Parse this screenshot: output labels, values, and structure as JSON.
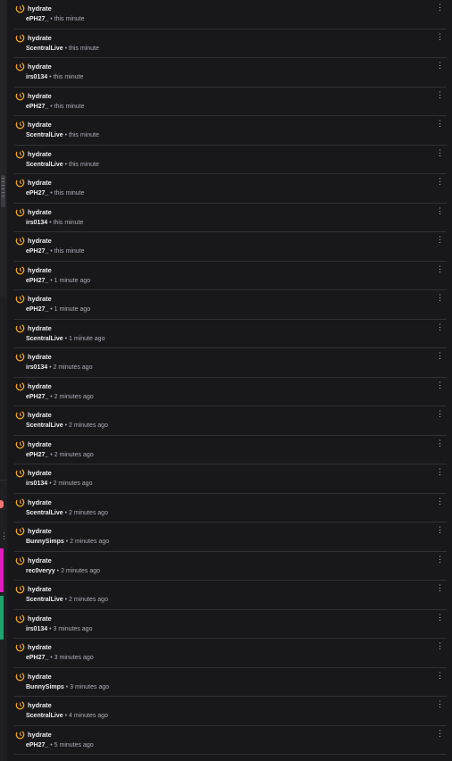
{
  "items": [
    {
      "title": "hydrate",
      "user": "ePH27_",
      "time": "this minute"
    },
    {
      "title": "hydrate",
      "user": "ScentralLive",
      "time": "this minute"
    },
    {
      "title": "hydrate",
      "user": "irs0134",
      "time": "this minute"
    },
    {
      "title": "hydrate",
      "user": "ePH27_",
      "time": "this minute"
    },
    {
      "title": "hydrate",
      "user": "ScentralLive",
      "time": "this minute"
    },
    {
      "title": "hydrate",
      "user": "ScentralLive",
      "time": "this minute"
    },
    {
      "title": "hydrate",
      "user": "ePH27_",
      "time": "this minute"
    },
    {
      "title": "hydrate",
      "user": "irs0134",
      "time": "this minute"
    },
    {
      "title": "hydrate",
      "user": "ePH27_",
      "time": "this minute"
    },
    {
      "title": "hydrate",
      "user": "ePH27_",
      "time": "1 minute ago"
    },
    {
      "title": "hydrate",
      "user": "ePH27_",
      "time": "1 minute ago"
    },
    {
      "title": "hydrate",
      "user": "ScentralLive",
      "time": "1 minute ago"
    },
    {
      "title": "hydrate",
      "user": "irs0134",
      "time": "2 minutes ago"
    },
    {
      "title": "hydrate",
      "user": "ePH27_",
      "time": "2 minutes ago"
    },
    {
      "title": "hydrate",
      "user": "ScentralLive",
      "time": "2 minutes ago"
    },
    {
      "title": "hydrate",
      "user": "ePH27_",
      "time": "2 minutes ago"
    },
    {
      "title": "hydrate",
      "user": "irs0134",
      "time": "2 minutes ago"
    },
    {
      "title": "hydrate",
      "user": "ScentralLive",
      "time": "2 minutes ago"
    },
    {
      "title": "hydrate",
      "user": "BunnySimps",
      "time": "2 minutes ago"
    },
    {
      "title": "hydrate",
      "user": "rec0veryy",
      "time": "2 minutes ago"
    },
    {
      "title": "hydrate",
      "user": "ScentralLive",
      "time": "2 minutes ago"
    },
    {
      "title": "hydrate",
      "user": "irs0134",
      "time": "3 minutes ago"
    },
    {
      "title": "hydrate",
      "user": "ePH27_",
      "time": "3 minutes ago"
    },
    {
      "title": "hydrate",
      "user": "BunnySimps",
      "time": "3 minutes ago"
    },
    {
      "title": "hydrate",
      "user": "ScentralLive",
      "time": "4 minutes ago"
    },
    {
      "title": "hydrate",
      "user": "ePH27_",
      "time": "5 minutes ago"
    }
  ],
  "separator": "•",
  "menu_glyph": "⋮",
  "icon": "reward-circle-icon",
  "colors": {
    "background": "#18181b",
    "icon": "#f5a623",
    "text": "#efeff1",
    "muted": "#adadb8",
    "accent_pink": "#f87171",
    "accent_magenta": "#e11cbd",
    "accent_green": "#1fa36b"
  }
}
